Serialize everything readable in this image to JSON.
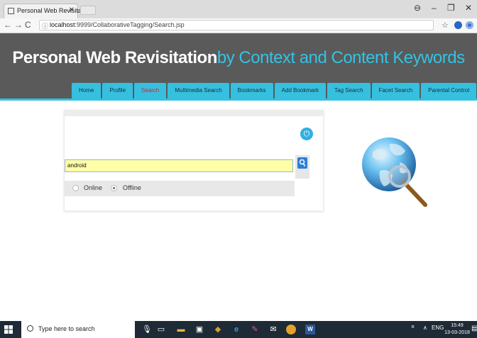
{
  "browser": {
    "tab_title": "Personal Web Revisitatio",
    "url_host": "localhost",
    "url_path": ":9999/CollaborativeTagging/Search.jsp"
  },
  "header": {
    "brand_main": "Personal Web Revisitation",
    "brand_tail": "by Context and Content Keywords"
  },
  "menu": {
    "items": [
      {
        "label": "Home"
      },
      {
        "label": "Profile"
      },
      {
        "label": "Search",
        "active": true
      },
      {
        "label": "Multimedia Search"
      },
      {
        "label": "Bookmarks"
      },
      {
        "label": "Add Bookmark"
      },
      {
        "label": "Tag Search"
      },
      {
        "label": "Facet Search"
      },
      {
        "label": "Parental Control"
      }
    ],
    "accent": "#36c0e0",
    "active_color": "#d2232a"
  },
  "search": {
    "value": "android",
    "options": [
      {
        "label": "Online",
        "selected": false
      },
      {
        "label": "Offline",
        "selected": true
      }
    ]
  },
  "taskbar": {
    "search_placeholder": "Type here to search",
    "lang": "ENG",
    "time": "15:49",
    "date": "13-03-2018"
  }
}
